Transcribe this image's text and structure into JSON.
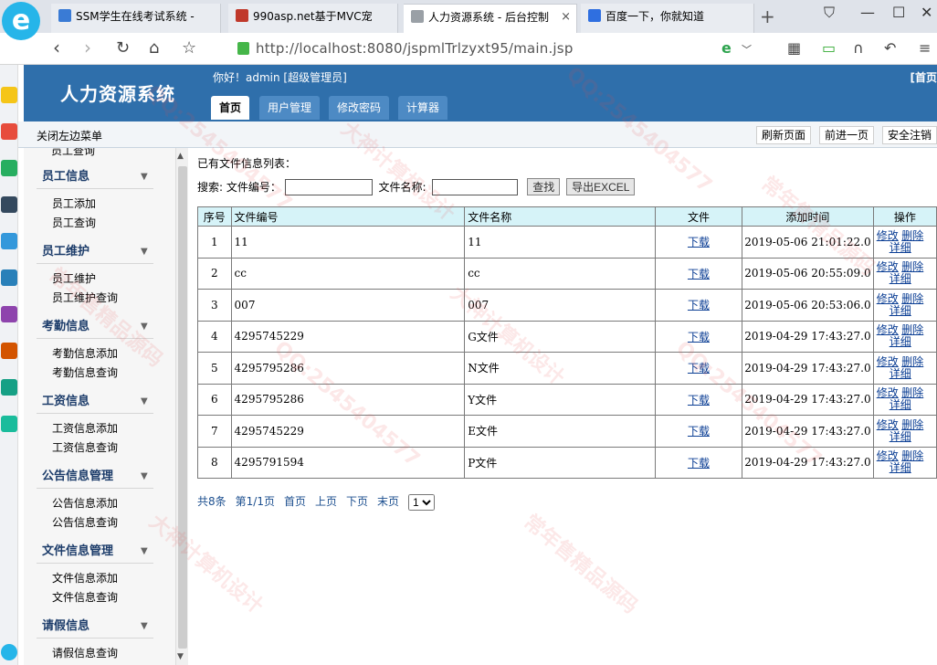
{
  "browser": {
    "tabs": [
      {
        "label": "SSM学生在线考试系统 -",
        "icon_color": "#3a7bd5"
      },
      {
        "label": "990asp.net基于MVC宠",
        "icon_color": "#c0392b"
      },
      {
        "label": "人力资源系统 - 后台控制",
        "icon_color": "#9aa0a6",
        "close": "×"
      },
      {
        "label": "百度一下，你就知道",
        "icon_color": "#2f6fe0"
      }
    ],
    "new_tab": "+",
    "url": "http://localhost:8080/jspmlTrlzyxt95/main.jsp"
  },
  "app": {
    "title": "人力资源系统",
    "greeting": "你好！admin [超级管理员]",
    "home_link": "[首页",
    "nav_tabs": [
      "首页",
      "用户管理",
      "修改密码",
      "计算器"
    ],
    "close_menu": "关闭左边菜单",
    "toolbar_buttons": [
      "刷新页面",
      "前进一页",
      "安全注销"
    ]
  },
  "menu": {
    "cut_item": "员工查询",
    "sections": [
      {
        "title": "员工信息",
        "items": [
          "员工添加",
          "员工查询"
        ]
      },
      {
        "title": "员工维护",
        "items": [
          "员工维护",
          "员工维护查询"
        ]
      },
      {
        "title": "考勤信息",
        "items": [
          "考勤信息添加",
          "考勤信息查询"
        ]
      },
      {
        "title": "工资信息",
        "items": [
          "工资信息添加",
          "工资信息查询"
        ]
      },
      {
        "title": "公告信息管理",
        "items": [
          "公告信息添加",
          "公告信息查询"
        ]
      },
      {
        "title": "文件信息管理",
        "items": [
          "文件信息添加",
          "文件信息查询"
        ]
      },
      {
        "title": "请假信息",
        "items": [
          "请假信息查询"
        ]
      }
    ],
    "arrow": "▼"
  },
  "main": {
    "list_title": "已有文件信息列表：",
    "search": {
      "label": "搜索: 文件编号：",
      "name_label": "文件名称:",
      "search_button": "查找",
      "export_button": "导出EXCEL",
      "no_value": "",
      "name_value": ""
    },
    "columns": [
      "序号",
      "文件编号",
      "文件名称",
      "文件",
      "添加时间",
      "操作"
    ],
    "rows": [
      {
        "idx": "1",
        "no": "11",
        "name": "11",
        "file": "下载",
        "time": "2019-05-06 21:01:22.0"
      },
      {
        "idx": "2",
        "no": "cc",
        "name": "cc",
        "file": "下载",
        "time": "2019-05-06 20:55:09.0"
      },
      {
        "idx": "3",
        "no": "007",
        "name": "007",
        "file": "下载",
        "time": "2019-05-06 20:53:06.0"
      },
      {
        "idx": "4",
        "no": "4295745229",
        "name": "G文件",
        "file": "下载",
        "time": "2019-04-29 17:43:27.0"
      },
      {
        "idx": "5",
        "no": "4295795286",
        "name": "N文件",
        "file": "下载",
        "time": "2019-04-29 17:43:27.0"
      },
      {
        "idx": "6",
        "no": "4295795286",
        "name": "Y文件",
        "file": "下载",
        "time": "2019-04-29 17:43:27.0"
      },
      {
        "idx": "7",
        "no": "4295745229",
        "name": "E文件",
        "file": "下载",
        "time": "2019-04-29 17:43:27.0"
      },
      {
        "idx": "8",
        "no": "4295791594",
        "name": "P文件",
        "file": "下载",
        "time": "2019-04-29 17:43:27.0"
      }
    ],
    "ops": {
      "edit": "修改",
      "delete": "删除",
      "detail": "详细"
    },
    "pager": {
      "total": "共8条",
      "page": "第1/1页",
      "first": "首页",
      "prev": "上页",
      "next": "下页",
      "last": "末页",
      "selected": "1"
    }
  },
  "watermarks": [
    "QQ:2545404577",
    "大神计算机设计",
    "常年售精品源码"
  ],
  "colors": {
    "header_bg": "#2f6fab",
    "table_header_bg": "#d6f3f8",
    "link": "#0b3e94"
  }
}
